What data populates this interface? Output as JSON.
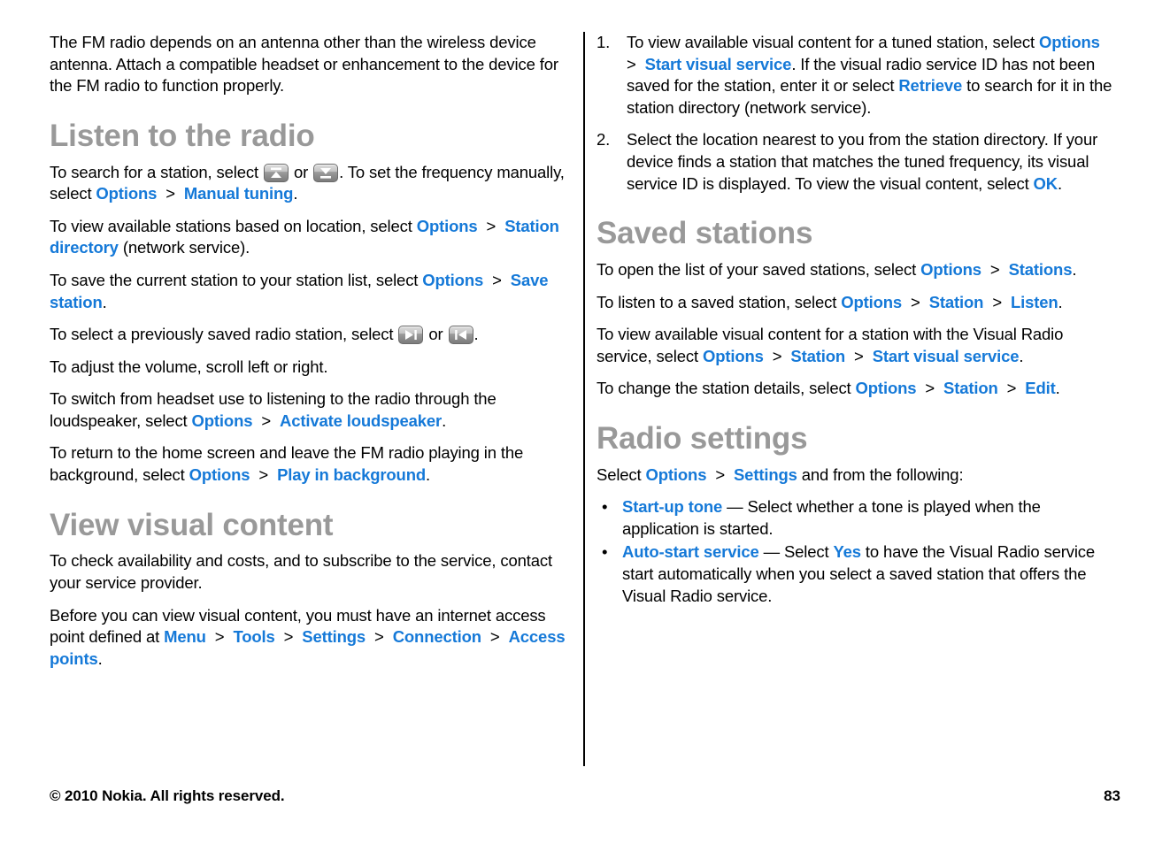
{
  "document": {
    "page_number": "83",
    "copyright": "© 2010 Nokia. All rights reserved."
  },
  "colors": {
    "link_blue": "#1579d8",
    "heading_gray": "#999999",
    "body_black": "#000000"
  },
  "left_column": {
    "intro_paragraph": "The FM radio depends on an antenna other than the wireless device antenna. Attach a compatible headset or enhancement to the device for the FM radio to function properly.",
    "section_listen": {
      "heading": "Listen to the radio",
      "p1": {
        "t1": "To search for a station, select ",
        "icon1": "scan-up-icon",
        "t2": " or ",
        "icon2": "scan-down-icon",
        "t3": ". To set the frequency manually, select ",
        "ui1": "Options",
        "sep1": ">",
        "ui2": "Manual tuning",
        "t4": "."
      },
      "p2": {
        "t1": "To view available stations based on location, select ",
        "ui1": "Options",
        "sep1": ">",
        "ui2": "Station directory",
        "t2": " (network service)."
      },
      "p3": {
        "t1": "To save the current station to your station list, select ",
        "ui1": "Options",
        "sep1": ">",
        "ui2": "Save station",
        "t2": "."
      },
      "p4": {
        "t1": "To select a previously saved radio station, select ",
        "icon1": "next-station-icon",
        "t2": " or ",
        "icon2": "previous-station-icon",
        "t3": "."
      },
      "p5": {
        "t1": "To adjust the volume, scroll left or right."
      },
      "p6": {
        "t1": "To switch from headset use to listening to the radio through the loudspeaker, select ",
        "ui1": "Options",
        "sep1": ">",
        "ui2": "Activate loudspeaker",
        "t2": "."
      },
      "p7": {
        "t1": "To return to the home screen and leave the FM radio playing in the background, select ",
        "ui1": "Options",
        "sep1": ">",
        "ui2": "Play in background",
        "t2": "."
      }
    },
    "section_visual": {
      "heading": "View visual content",
      "p1": {
        "t1": "To check availability and costs, and to subscribe to the service, contact your service provider."
      },
      "p2": {
        "t1": "Before you can view visual content, you must have an internet access point defined at ",
        "ui1": "Menu",
        "sep1": ">",
        "ui2": "Tools",
        "sep2": ">",
        "ui3": "Settings",
        "sep3": ">",
        "ui4": "Connection",
        "sep4": ">",
        "ui5": "Access points",
        "t2": "."
      }
    }
  },
  "right_column": {
    "steps": [
      {
        "num": "1.",
        "t1": "To view available visual content for a tuned station, select ",
        "ui1": "Options",
        "sep1": ">",
        "ui2": "Start visual service",
        "t2": ". If the visual radio service ID has not been saved for the station, enter it or select ",
        "ui3": "Retrieve",
        "t3": " to search for it in the station directory (network service)."
      },
      {
        "num": "2.",
        "t1": "Select the location nearest to you from the station directory. If your device finds a station that matches the tuned frequency, its visual service ID is displayed. To view the visual content, select ",
        "ui1": "OK",
        "t2": "."
      }
    ],
    "section_saved": {
      "heading": "Saved stations",
      "p1": {
        "t1": "To open the list of your saved stations, select ",
        "ui1": "Options",
        "sep1": ">",
        "ui2": "Stations",
        "t2": "."
      },
      "p2": {
        "t1": "To listen to a saved station, select ",
        "ui1": "Options",
        "sep1": ">",
        "ui2": "Station",
        "sep2": ">",
        "ui3": "Listen",
        "t2": "."
      },
      "p3": {
        "t1": "To view available visual content for a station with the Visual Radio service, select ",
        "ui1": "Options",
        "sep1": ">",
        "ui2": "Station",
        "sep2": ">",
        "ui3": "Start visual service",
        "t2": "."
      },
      "p4": {
        "t1": "To change the station details, select ",
        "ui1": "Options",
        "sep1": ">",
        "ui2": "Station",
        "sep2": ">",
        "ui3": "Edit",
        "t2": "."
      }
    },
    "section_settings": {
      "heading": "Radio settings",
      "intro": {
        "t1": "Select ",
        "ui1": "Options",
        "sep1": ">",
        "ui2": "Settings",
        "t2": " and from the following:"
      },
      "bullets": [
        {
          "bullet": "•",
          "ui1": "Start-up tone",
          "t1": "  — Select whether a tone is played when the application is started."
        },
        {
          "bullet": "•",
          "ui1": "Auto-start service",
          "t1": "  — Select ",
          "ui2": "Yes",
          "t2": " to have the Visual Radio service start automatically when you select a saved station that offers the Visual Radio service."
        }
      ]
    }
  }
}
